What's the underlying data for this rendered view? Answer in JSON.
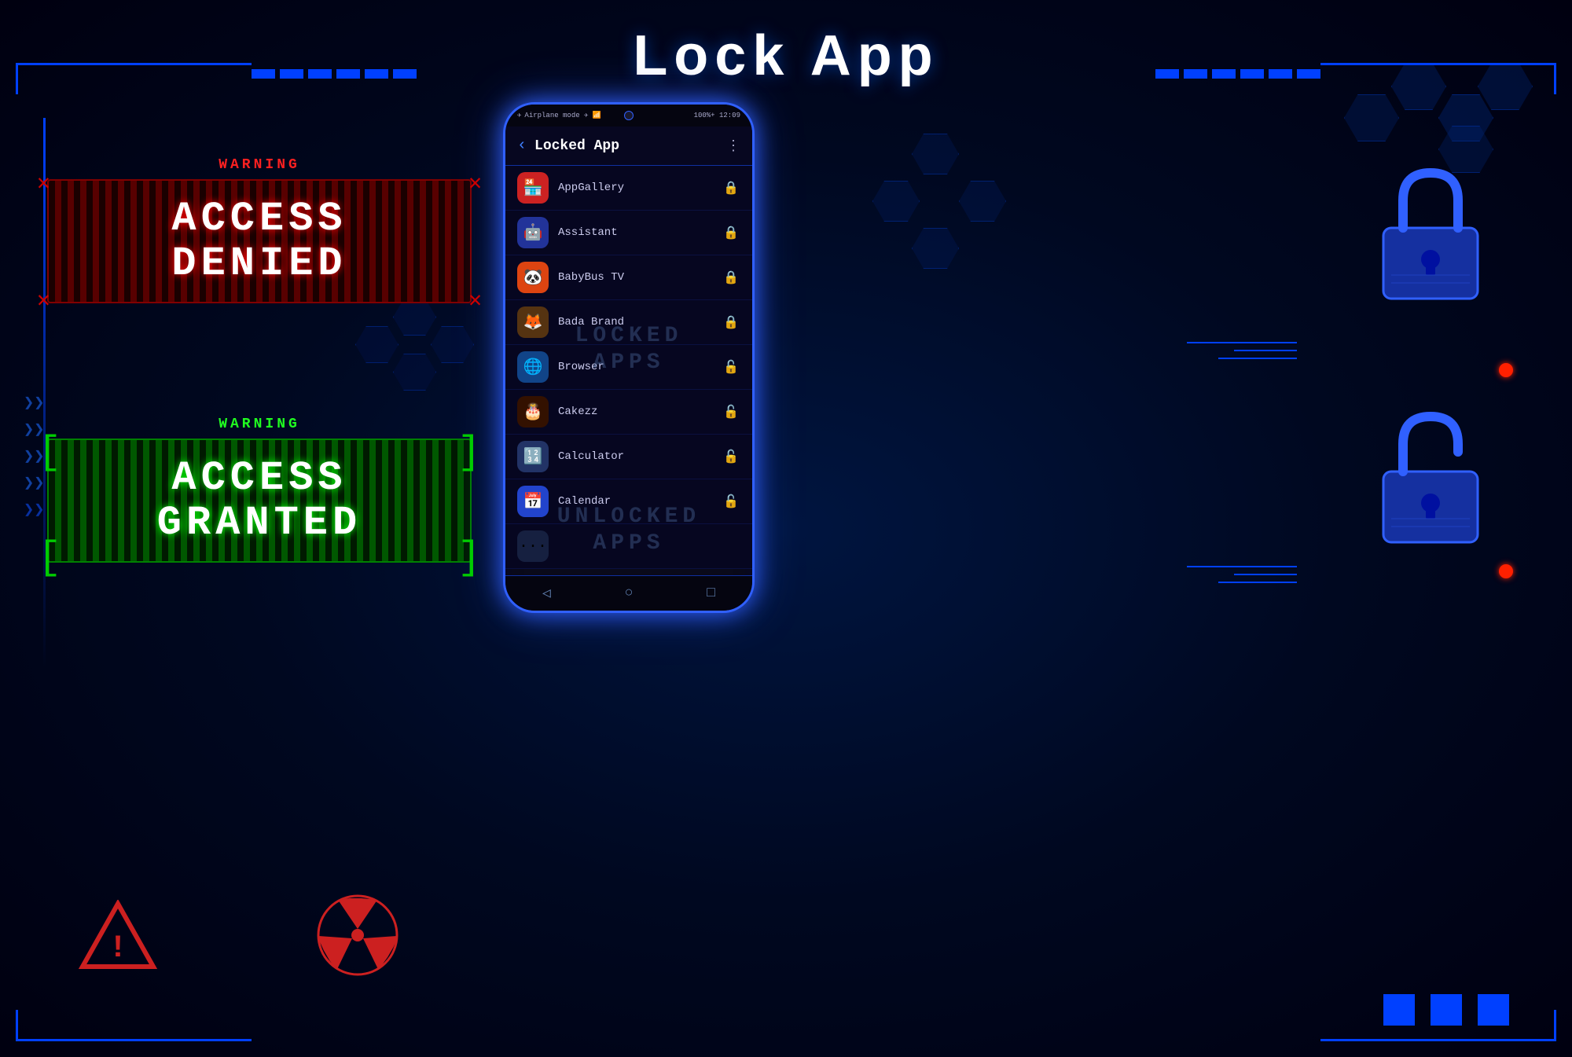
{
  "page": {
    "title": "Lock  App",
    "background_color": "#000010"
  },
  "access_denied": {
    "warning_label": "WARNING",
    "text_line1": "ACCESS",
    "text_line2": "DENIED"
  },
  "access_granted": {
    "warning_label": "WARNING",
    "text_line1": "ACCESS",
    "text_line2": "GRANTED"
  },
  "phone": {
    "status_bar": {
      "left": "Airplane mode ✈ 📶",
      "right": "100%+ 12:09"
    },
    "header": {
      "title": "Locked App",
      "back_label": "‹",
      "menu_label": "⋮"
    },
    "apps": [
      {
        "name": "AppGallery",
        "icon": "🏪",
        "icon_bg": "#cc2222",
        "locked": true
      },
      {
        "name": "Assistant",
        "icon": "🤖",
        "icon_bg": "#223399",
        "locked": true
      },
      {
        "name": "BabyBus TV",
        "icon": "🐼",
        "icon_bg": "#dd4411",
        "locked": true
      },
      {
        "name": "Bada Brand",
        "icon": "🦊",
        "icon_bg": "#553311",
        "locked": true
      },
      {
        "name": "Browser",
        "icon": "🌐",
        "icon_bg": "#114488",
        "locked": false
      },
      {
        "name": "Cakezz",
        "icon": "🍰",
        "icon_bg": "#331100",
        "locked": false
      },
      {
        "name": "Calculator",
        "icon": "🔢",
        "icon_bg": "#223366",
        "locked": false
      },
      {
        "name": "Calendar",
        "icon": "📅",
        "icon_bg": "#2244cc",
        "locked": false
      }
    ],
    "overlay_locked": {
      "line1": "LOCKED",
      "line2": "APPS"
    },
    "overlay_unlocked": {
      "line1": "UNLOCKED",
      "line2": "APPS"
    },
    "nav": {
      "back": "◁",
      "home": "○",
      "recent": "□"
    }
  }
}
